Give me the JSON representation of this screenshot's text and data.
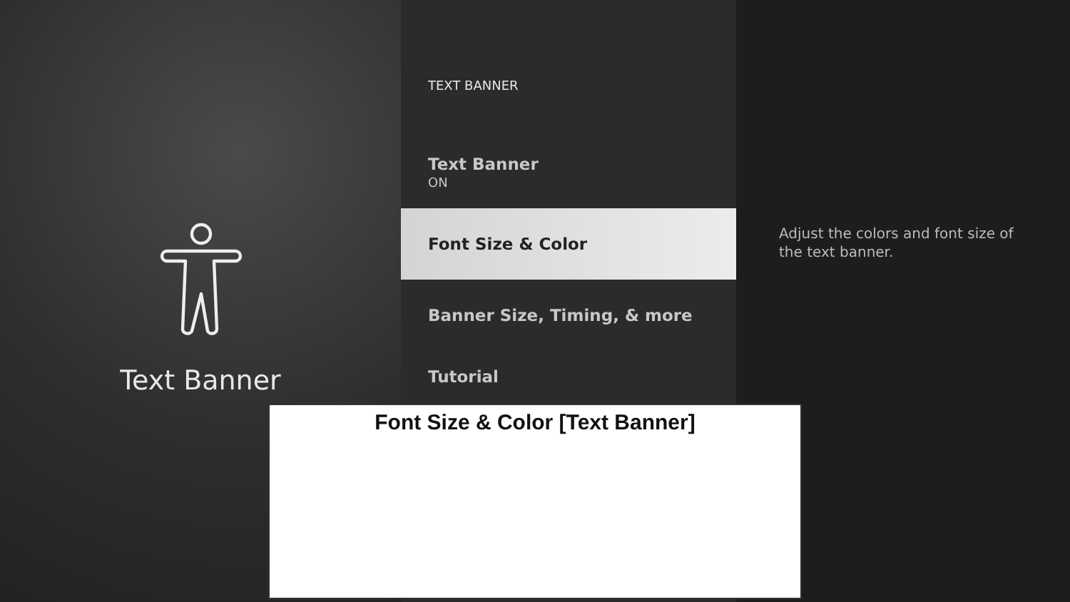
{
  "sidebar": {
    "title": "Text Banner"
  },
  "menu": {
    "heading": "TEXT BANNER",
    "items": [
      {
        "label": "Text Banner",
        "value": "ON",
        "selected": false
      },
      {
        "label": "Font Size & Color",
        "selected": true
      },
      {
        "label": "Banner Size, Timing, & more",
        "selected": false
      },
      {
        "label": "Tutorial",
        "selected": false
      }
    ]
  },
  "description": "Adjust the colors and font size of the text banner.",
  "banner_preview": {
    "title": "Font Size & Color [Text Banner]"
  }
}
